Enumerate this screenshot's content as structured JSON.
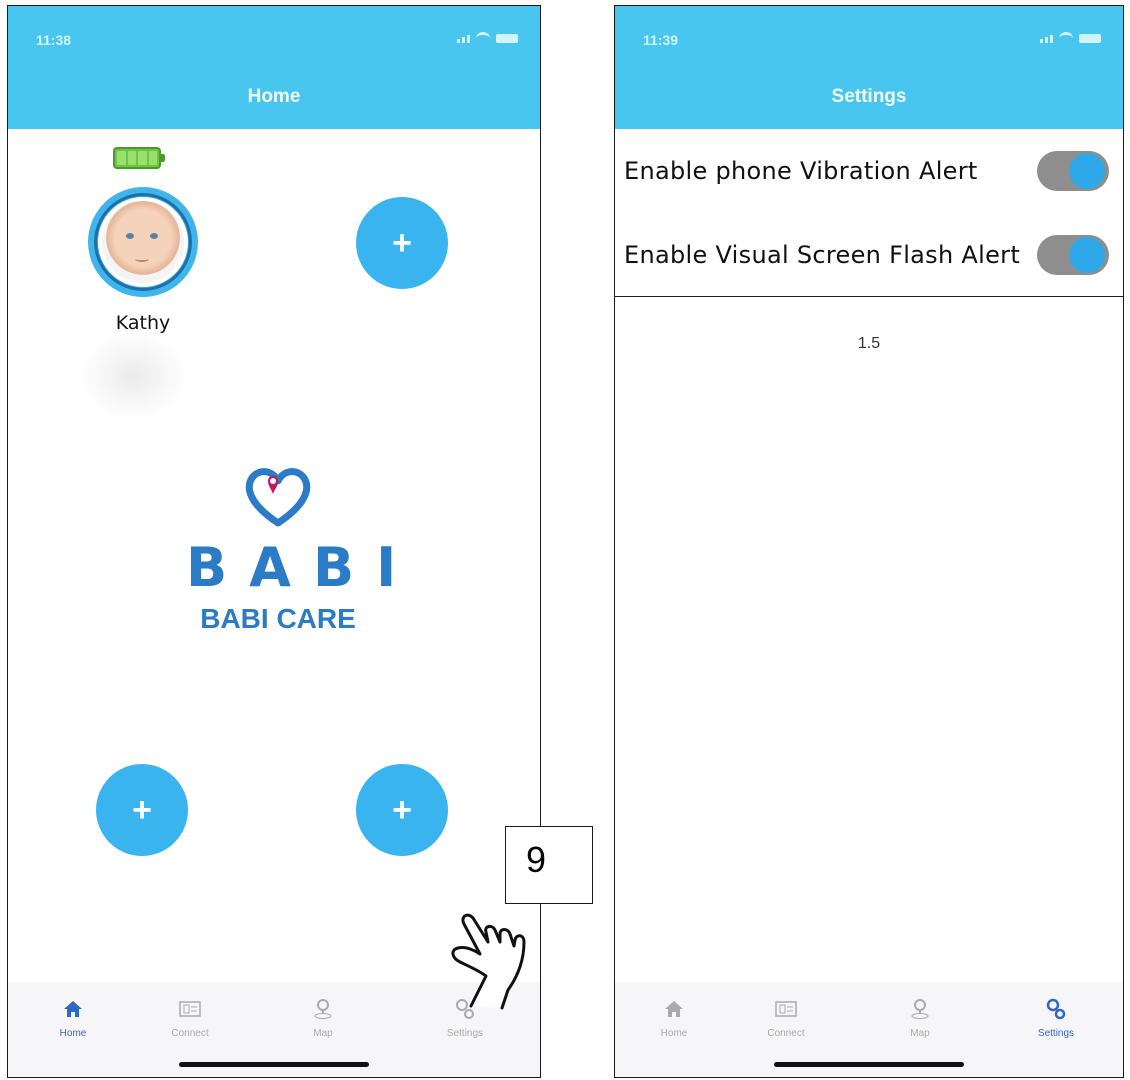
{
  "left_screen": {
    "status_time": "11:38",
    "title": "Home",
    "child_profile": {
      "name": "Kathy",
      "battery_level": 1.0
    },
    "add_buttons": [
      "+",
      "+",
      "+"
    ],
    "logo": {
      "word": "BABI",
      "subtitle": "BABI CARE"
    },
    "tabs": [
      {
        "label": "Home",
        "icon": "home-icon"
      },
      {
        "label": "Connect",
        "icon": "connect-icon"
      },
      {
        "label": "Map",
        "icon": "map-pin-icon"
      },
      {
        "label": "Settings",
        "icon": "settings-icon"
      }
    ],
    "active_tab": "Home"
  },
  "callout": {
    "step": "9",
    "icon": "pointing-hand-icon"
  },
  "right_screen": {
    "status_time": "11:39",
    "title": "Settings",
    "settings": [
      {
        "label": "Enable phone Vibration Alert",
        "enabled": true
      },
      {
        "label": "Enable Visual Screen Flash Alert",
        "enabled": true
      }
    ],
    "version": "1.5",
    "tabs": [
      {
        "label": "Home",
        "icon": "home-icon"
      },
      {
        "label": "Connect",
        "icon": "connect-icon"
      },
      {
        "label": "Map",
        "icon": "map-pin-icon"
      },
      {
        "label": "Settings",
        "icon": "settings-icon"
      }
    ],
    "active_tab": "Settings"
  },
  "colors": {
    "header": "#49c6ef",
    "accent": "#3ab4ee",
    "logo": "#2b7bc6",
    "active_tab": "#2f67c8",
    "battery": "#6fc34a"
  }
}
